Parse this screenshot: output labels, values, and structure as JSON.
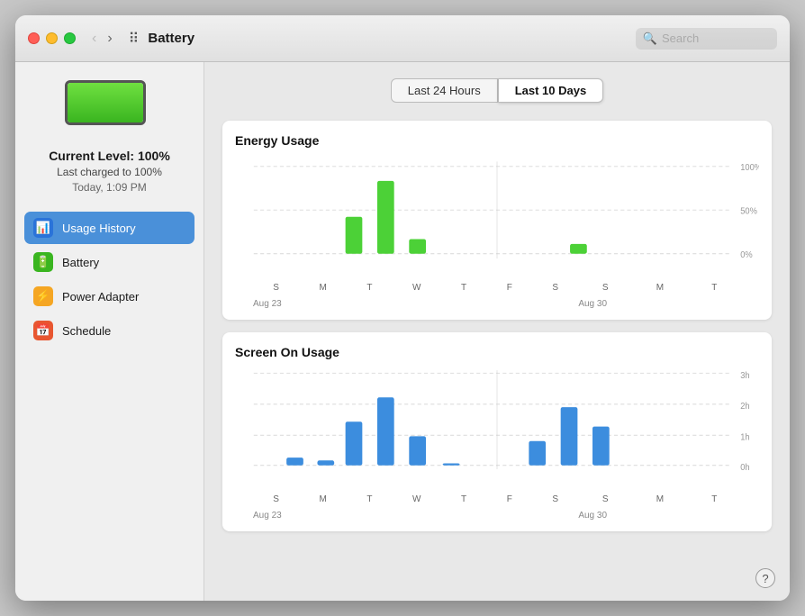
{
  "window": {
    "title": "Battery",
    "traffic_lights": [
      "red",
      "yellow",
      "green"
    ]
  },
  "search": {
    "placeholder": "Search"
  },
  "sidebar": {
    "battery_level_label": "Current Level: 100%",
    "battery_charged_label": "Last charged to 100%",
    "battery_time_label": "Today, 1:09 PM",
    "items": [
      {
        "id": "usage-history",
        "label": "Usage History",
        "icon": "📊",
        "icon_class": "icon-blue",
        "active": true
      },
      {
        "id": "battery",
        "label": "Battery",
        "icon": "🔋",
        "icon_class": "icon-green",
        "active": false
      },
      {
        "id": "power-adapter",
        "label": "Power Adapter",
        "icon": "⚡",
        "icon_class": "icon-orange",
        "active": false
      },
      {
        "id": "schedule",
        "label": "Schedule",
        "icon": "📅",
        "icon_class": "icon-red",
        "active": false
      }
    ]
  },
  "tabs": [
    {
      "id": "last-24h",
      "label": "Last 24 Hours",
      "active": false
    },
    {
      "id": "last-10d",
      "label": "Last 10 Days",
      "active": true
    }
  ],
  "energy_chart": {
    "title": "Energy Usage",
    "y_labels": [
      "100%",
      "50%",
      "0%"
    ],
    "week1": {
      "days": [
        "S",
        "M",
        "T",
        "W",
        "T",
        "F",
        "S"
      ],
      "date": "Aug 23",
      "values": [
        0,
        0,
        0,
        38,
        75,
        15,
        0
      ]
    },
    "week2": {
      "days": [
        "S",
        "M",
        "T"
      ],
      "date": "Aug 30",
      "values": [
        0,
        10,
        0
      ]
    }
  },
  "screen_chart": {
    "title": "Screen On Usage",
    "y_labels": [
      "3h",
      "2h",
      "1h",
      "0h"
    ],
    "week1": {
      "days": [
        "S",
        "M",
        "T",
        "W",
        "T",
        "F",
        "S"
      ],
      "date": "Aug 23",
      "values": [
        0,
        8,
        5,
        45,
        70,
        30,
        2
      ]
    },
    "week2": {
      "days": [
        "S",
        "M",
        "T"
      ],
      "date": "Aug 30",
      "values": [
        25,
        60,
        40
      ]
    }
  },
  "help_button_label": "?"
}
